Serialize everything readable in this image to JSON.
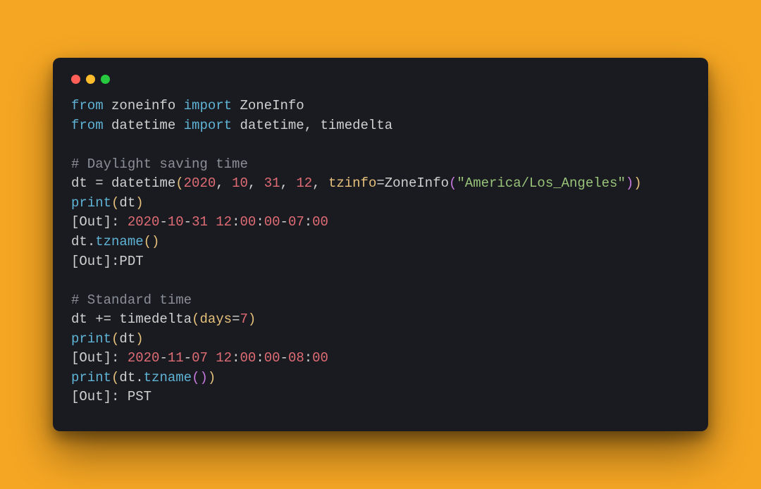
{
  "window": {
    "traffic": [
      "close",
      "minimize",
      "zoom"
    ]
  },
  "code": {
    "l1_from": "from",
    "l1_mod": "zoneinfo",
    "l1_import": "import",
    "l1_cls": "ZoneInfo",
    "l2_from": "from",
    "l2_mod": "datetime",
    "l2_import": "import",
    "l2_n1": "datetime",
    "l2_comma": ",",
    "l2_n2": "timedelta",
    "c1": "# Daylight saving time",
    "dt": "dt",
    "eq": " = ",
    "dtcls": "datetime",
    "lp": "(",
    "n2020": "2020",
    "cc": ", ",
    "n10": "10",
    "n31": "31",
    "n12": "12",
    "tzinfo": "tzinfo",
    "eq2": "=",
    "zoneinfo_call": "ZoneInfo",
    "tzstr": "\"America/Los_Angeles\"",
    "rp": ")",
    "rp2": "))",
    "print": "print",
    "outlabel": "[Out]",
    "colon": ":",
    "sp": " ",
    "out1_date": "2020",
    "out1_dash": "-",
    "out1_m": "10",
    "out1_d": "31",
    "out1_time": "12",
    "out1_zz": "00",
    "out1_tz": "07",
    "tzname": "tzname",
    "dot": ".",
    "pdt": "PDT",
    "c2": "# Standard time",
    "pluseq": " += ",
    "timedelta": "timedelta",
    "days": "days",
    "n7": "7",
    "out2_m": "11",
    "out2_d": "07",
    "out2_tz": "08",
    "pst": "PST"
  }
}
